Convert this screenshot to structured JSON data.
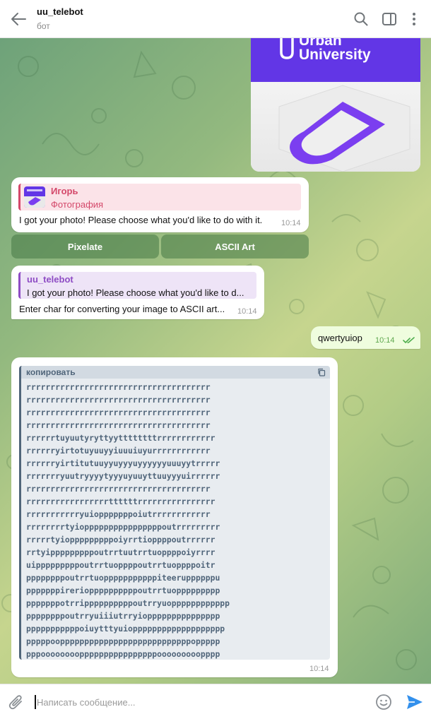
{
  "header": {
    "title": "uu_telebot",
    "subtitle": "бот",
    "icons": [
      "back-arrow-icon",
      "search-icon",
      "sidebar-toggle-icon",
      "more-vertical-icon"
    ]
  },
  "photo_message": {
    "logo_line1": "Urban",
    "logo_line2": "University",
    "brand_color": "#6236e6"
  },
  "bot_message_1": {
    "reply_name": "Игорь",
    "reply_text": "Фотография",
    "text": "I got your photo! Please choose what you'd like to do with it.",
    "time": "10:14",
    "buttons": [
      "Pixelate",
      "ASCII Art"
    ]
  },
  "bot_message_2": {
    "reply_name": "uu_telebot",
    "reply_text": "I got your photo! Please choose what you'd like to d...",
    "text": "Enter char for converting your image to ASCII art...",
    "time": "10:14"
  },
  "user_message": {
    "text": "qwertyuiop",
    "time": "10:14",
    "status": "read"
  },
  "ascii_message": {
    "copy_label": "копировать",
    "time": "10:14",
    "lines": [
      "rrrrrrrrrrrrrrrrrrrrrrrrrrrrrrrrrrrrrr",
      "rrrrrrrrrrrrrrrrrrrrrrrrrrrrrrrrrrrrrr",
      "rrrrrrrrrrrrrrrrrrrrrrrrrrrrrrrrrrrrrr",
      "rrrrrrrrrrrrrrrrrrrrrrrrrrrrrrrrrrrrrr",
      "rrrrrrtuyuutyryttyyttttttttrrrrrrrrrrrr",
      "rrrrrryirtotuyuuyyiuuuiuyurrrrrrrrrrrr",
      "rrrrrryirtitutuuyyuyyyuyyyyyyuuuyytrrrrr",
      "rrrrrrryuutryyyytyyyuyuuyttuuyyyuirrrrrr",
      "rrrrrrrrrrrrrrrrrrrrrrrrrrrrrrrrrrrrrr",
      "rrrrrrrrrrrrrrrrrttttttrrrrrrrrrrrrrrrr",
      "rrrrrrrrrrryuiopppppppoiutrrrrrrrrrrrr",
      "rrrrrrrrtyioppppppppppppppppoutrrrrrrrrr",
      "rrrrrtyiopppppppppoiyrrtioppppoutrrrrrr",
      "rrtyipppppppppoutrrtuutrrtuoppppoiyrrrr",
      "uipppppppppoutrrtuoppppoutrrtuoppppoitr",
      "ppppppppoutrrtuopppppppppppiteeruppppppu",
      "pppppppirerioppppppppppoutrrtuoppppppppp",
      "pppppppotrrippppppppppoutrryuopppppppppppp",
      "ppppppppoutrryuiiiutrryioppppppppppppppp",
      "pppppppppppoiuytttyuioppppppppppppppppppp",
      "pppppoopppppppppppppppppppppppppppoppppp",
      "pppooooooooppppppppppppppppooooooooopppp"
    ]
  },
  "composer": {
    "placeholder": "Написать сообщение...",
    "value": ""
  },
  "colors": {
    "accent": "#3390ec",
    "read_check": "#4fae4e",
    "code_text": "#50657a",
    "reply_pink": "#d4486a",
    "reply_purple": "#8e4cc4"
  }
}
